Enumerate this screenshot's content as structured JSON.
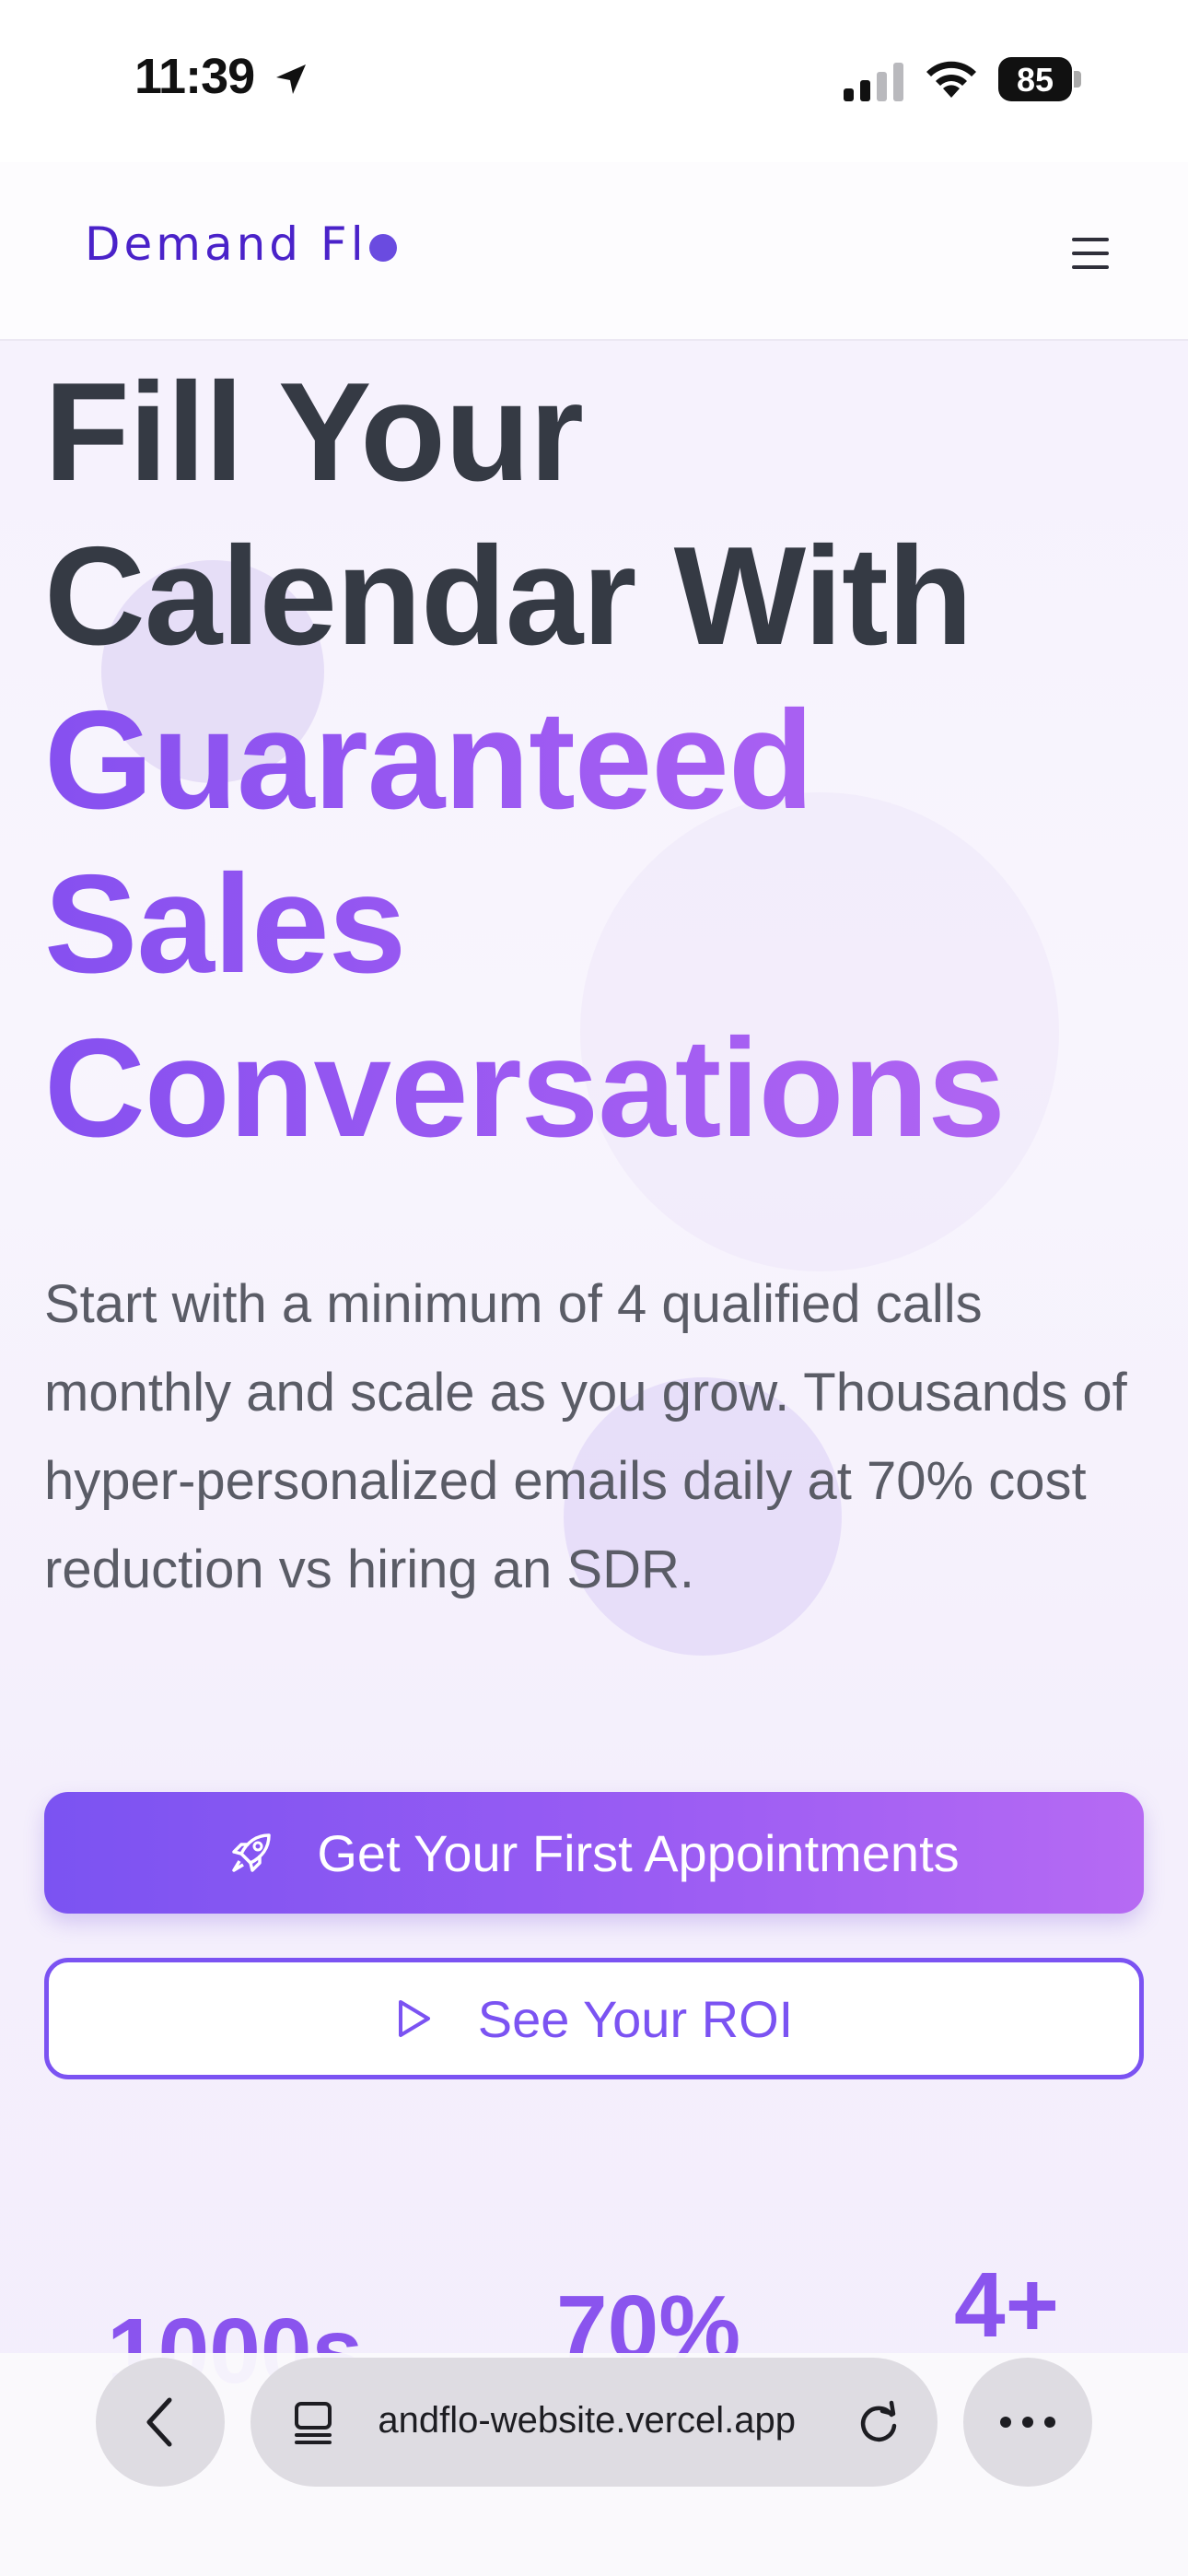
{
  "status_bar": {
    "time": "11:39",
    "battery": "85"
  },
  "nav": {
    "logo_text": "Demand Fl",
    "icons": [
      "location-arrow-icon",
      "signal-icon",
      "wifi-icon",
      "battery-icon",
      "menu-icon"
    ]
  },
  "hero": {
    "title_line1": "Fill Your",
    "title_line2": "Calendar With",
    "title_line3": "Guaranteed",
    "title_line4": "Sales",
    "title_line5": "Conversations",
    "description": "Start with a minimum of 4 qualified calls monthly and scale as you grow. Thousands of hyper-personalized emails daily at 70% cost reduction vs hiring an SDR.",
    "primary_button": "Get Your First Appointments",
    "secondary_button": "See Your ROI"
  },
  "stats": {
    "stat1": "1000s",
    "stat2": "70%",
    "stat3": "4+"
  },
  "browser": {
    "url": "andflo-website.vercel.app"
  },
  "colors": {
    "accent": "#7b53f2",
    "gradient_end": "#b66af3",
    "title_dark": "#353a44",
    "logo": "#4a22c9"
  }
}
